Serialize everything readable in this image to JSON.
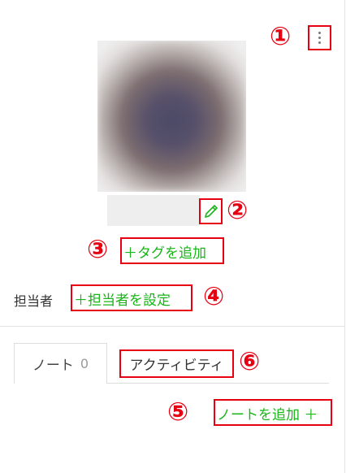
{
  "annotations": {
    "m1": "①",
    "m2": "②",
    "m3": "③",
    "m4": "④",
    "m5": "⑤",
    "m6": "⑥"
  },
  "profile": {
    "menu_icon": "kebab-vertical-icon",
    "edit_icon": "pencil-icon",
    "add_tag_label": "＋タグを追加"
  },
  "assignee": {
    "label": "担当者",
    "set_label": "＋担当者を設定"
  },
  "tabs": [
    {
      "label": "ノート",
      "count": "0"
    },
    {
      "label": "アクティビティ"
    }
  ],
  "notes": {
    "add_note_label": "ノートを追加 ＋"
  },
  "colors": {
    "accent_green": "#18b518",
    "annotation_red": "#e60012"
  }
}
